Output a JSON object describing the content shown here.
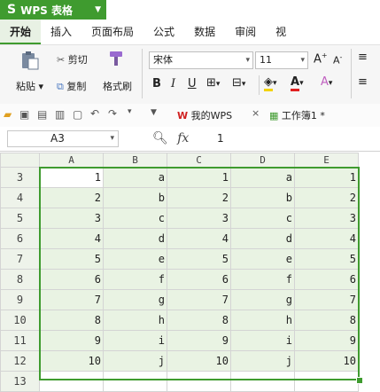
{
  "app": {
    "title": "WPS 表格",
    "logo": "S"
  },
  "tabs": [
    "开始",
    "插入",
    "页面布局",
    "公式",
    "数据",
    "审阅",
    "视"
  ],
  "ribbon": {
    "paste": "粘贴",
    "cut": "剪切",
    "copy": "复制",
    "format_painter": "格式刷",
    "font_name": "宋体",
    "font_size": "11",
    "bold": "B",
    "italic": "I",
    "underline": "U",
    "grow_font": "A",
    "shrink_font": "A"
  },
  "quick": {
    "my_wps": "我的WPS",
    "workbook_tab": "工作簿1 *"
  },
  "formula_bar": {
    "cell_ref": "A3",
    "fx": "fx",
    "value": "1"
  },
  "sheet": {
    "columns": [
      "A",
      "B",
      "C",
      "D",
      "E"
    ],
    "rows": [
      {
        "num": "3",
        "cells": [
          "1",
          "a",
          "1",
          "a",
          "1"
        ]
      },
      {
        "num": "4",
        "cells": [
          "2",
          "b",
          "2",
          "b",
          "2"
        ]
      },
      {
        "num": "5",
        "cells": [
          "3",
          "c",
          "3",
          "c",
          "3"
        ]
      },
      {
        "num": "6",
        "cells": [
          "4",
          "d",
          "4",
          "d",
          "4"
        ]
      },
      {
        "num": "7",
        "cells": [
          "5",
          "e",
          "5",
          "e",
          "5"
        ]
      },
      {
        "num": "8",
        "cells": [
          "6",
          "f",
          "6",
          "f",
          "6"
        ]
      },
      {
        "num": "9",
        "cells": [
          "7",
          "g",
          "7",
          "g",
          "7"
        ]
      },
      {
        "num": "10",
        "cells": [
          "8",
          "h",
          "8",
          "h",
          "8"
        ]
      },
      {
        "num": "11",
        "cells": [
          "9",
          "i",
          "9",
          "i",
          "9"
        ]
      },
      {
        "num": "12",
        "cells": [
          "10",
          "j",
          "10",
          "j",
          "10"
        ]
      }
    ],
    "next_row": "13"
  },
  "colors": {
    "accent": "#3f9b2f",
    "selection_fill": "#e9f3e3"
  }
}
